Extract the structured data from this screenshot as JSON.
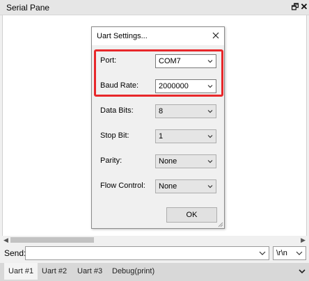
{
  "pane": {
    "title": "Serial Pane",
    "restore_glyph": "🗗",
    "close_glyph": "✕"
  },
  "dialog": {
    "title": "Uart Settings...",
    "fields": {
      "port": {
        "label": "Port:",
        "value": "COM7"
      },
      "baud_rate": {
        "label": "Baud Rate:",
        "value": "2000000"
      },
      "data_bits": {
        "label": "Data Bits:",
        "value": "8"
      },
      "stop_bit": {
        "label": "Stop Bit:",
        "value": "1"
      },
      "parity": {
        "label": "Parity:",
        "value": "None"
      },
      "flow_control": {
        "label": "Flow Control:",
        "value": "None"
      }
    },
    "ok_label": "OK"
  },
  "send": {
    "label": "Send:",
    "value": "",
    "eol_value": "\\r\\n"
  },
  "tabs": [
    "Uart #1",
    "Uart #2",
    "Uart #3",
    "Debug(print)"
  ],
  "active_tab": "Uart #1",
  "colors": {
    "highlight": "#e8272a",
    "pane_background": "#ffffff",
    "chrome": "#f0f0f0"
  },
  "icons": {
    "restore": "restore-icon",
    "close": "close-icon",
    "dropdown": "chevron-down-icon"
  }
}
